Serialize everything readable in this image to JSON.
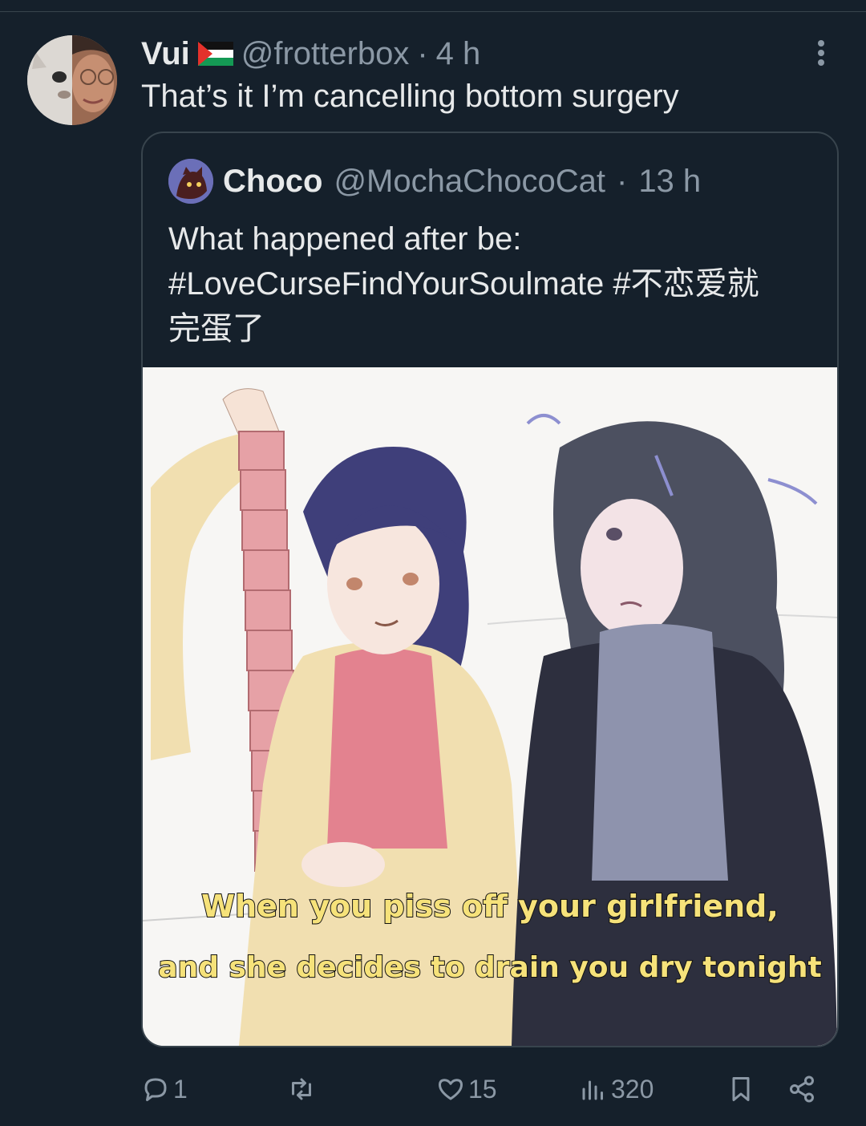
{
  "post": {
    "author_name": "Vui",
    "handle": "@frotterbox",
    "separator": "·",
    "time": "4 h",
    "text": "That’s it I’m cancelling bottom surgery"
  },
  "quote": {
    "author_name": "Choco",
    "handle": "@MochaChocoCat",
    "separator": "·",
    "time": "13 h",
    "text_line1": "What happened after be:",
    "text_line2": "#LoveCurseFindYourSoulmate #不恋爱就",
    "text_line3": "完蛋了",
    "caption_line1": "When you piss off your girlfriend,",
    "caption_line2": "and she decides to drain you dry tonight"
  },
  "actions": {
    "replies": "1",
    "retweets": "",
    "likes": "15",
    "views": "320"
  },
  "colors": {
    "background": "#15202b",
    "border": "#38444d",
    "muted": "#8b98a5",
    "text": "#e7e9ea",
    "caption": "#f6e27a"
  },
  "icons": [
    "more-icon",
    "reply-icon",
    "retweet-icon",
    "like-icon",
    "views-icon",
    "bookmark-icon",
    "share-icon",
    "palestine-flag-icon"
  ]
}
